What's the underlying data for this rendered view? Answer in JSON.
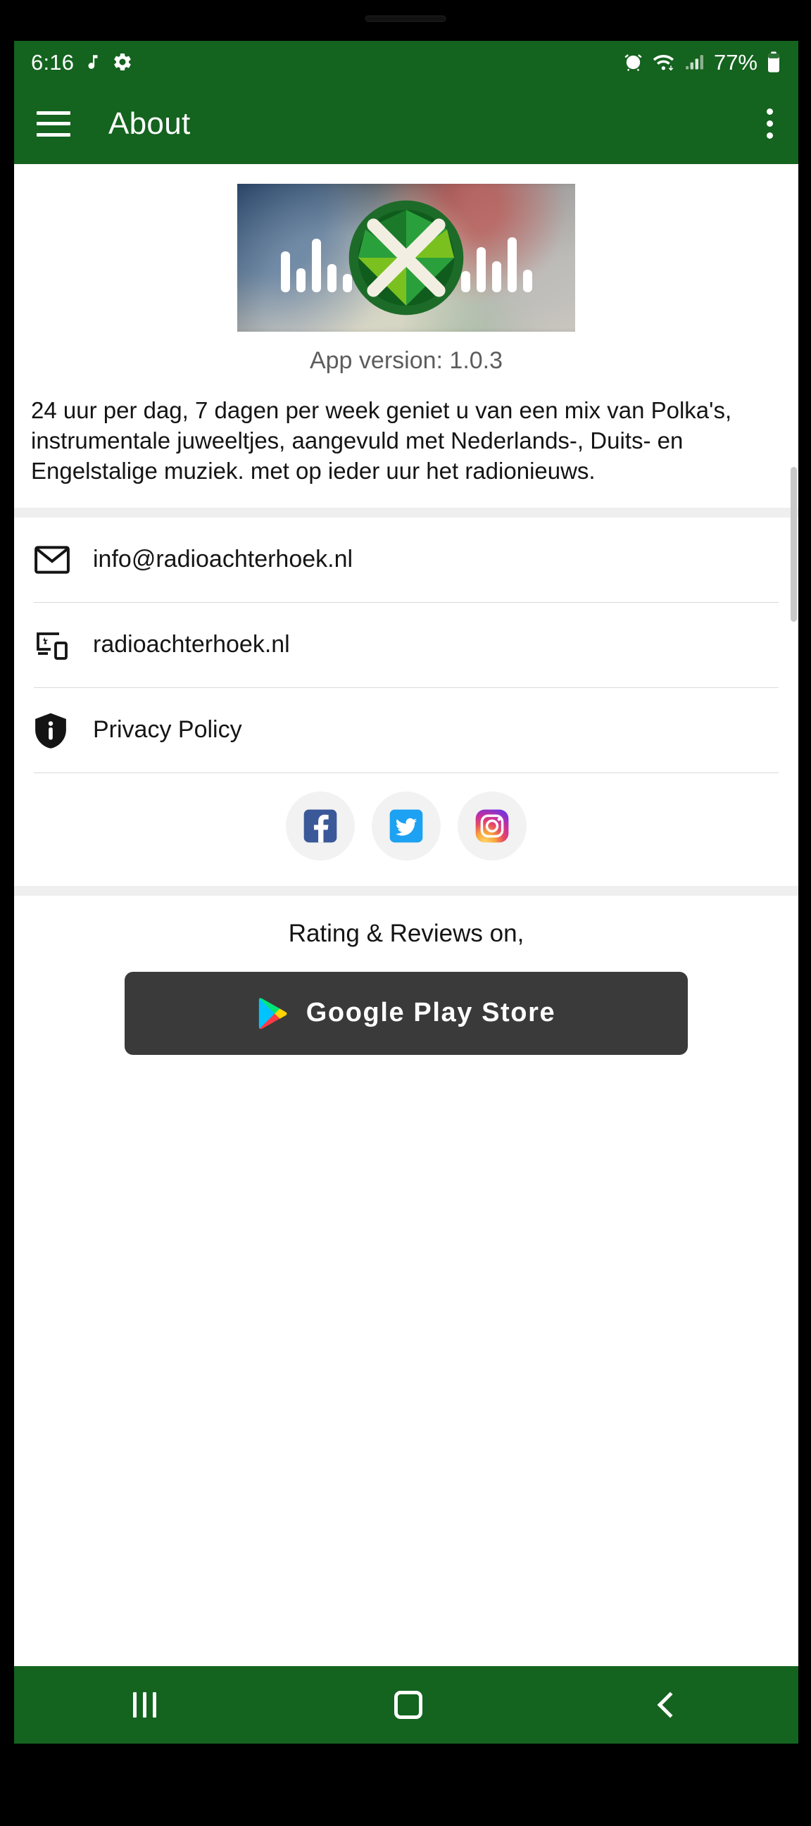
{
  "status_bar": {
    "time": "6:16",
    "battery_percent": "77%",
    "icons": [
      "music-note-icon",
      "gear-icon",
      "alarm-icon",
      "wifi-icon",
      "cellular-signal-icon",
      "battery-icon"
    ]
  },
  "app_bar": {
    "title": "About",
    "menu_icon": "hamburger-menu-icon",
    "overflow_icon": "overflow-menu-icon"
  },
  "main": {
    "banner_alt": "radio-studio-logo-banner",
    "version_label": "App version: 1.0.3",
    "description": "24 uur per dag, 7 dagen per week geniet u van een mix van Polka's, instrumentale juweeltjes, aangevuld met Nederlands-, Duits- en Engelstalige muziek. met op ieder uur het radionieuws.",
    "contact_rows": [
      {
        "icon": "email-icon",
        "label": "info@radioachterhoek.nl"
      },
      {
        "icon": "website-devices-icon",
        "label": "radioachterhoek.nl"
      },
      {
        "icon": "privacy-shield-icon",
        "label": "Privacy Policy"
      }
    ],
    "social": [
      {
        "name": "facebook-icon",
        "label": "Facebook",
        "color": "#3b5998"
      },
      {
        "name": "twitter-icon",
        "label": "Twitter",
        "color": "#1da1f2"
      },
      {
        "name": "instagram-icon",
        "label": "Instagram",
        "color": "#e1306c"
      }
    ],
    "rating_title": "Rating & Reviews on,",
    "play_store_label": "Google Play Store",
    "play_store_icon": "google-play-icon"
  },
  "nav_bar": {
    "recents_label": "Recents",
    "home_label": "Home",
    "back_label": "Back"
  },
  "colors": {
    "brand_green": "#14631f",
    "logo_light_green": "#7ac11f",
    "logo_dark_green": "#1d6b28",
    "button_dark": "#3a3a3a"
  }
}
